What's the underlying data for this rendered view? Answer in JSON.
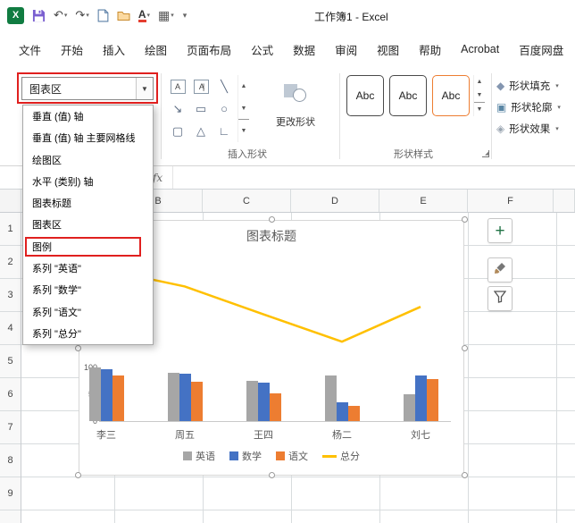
{
  "titlebar": {
    "title": "工作簿1 -  Excel"
  },
  "ribbon": {
    "tabs": [
      "文件",
      "开始",
      "插入",
      "绘图",
      "页面布局",
      "公式",
      "数据",
      "审阅",
      "视图",
      "帮助",
      "Acrobat",
      "百度网盘"
    ],
    "selection_combo": {
      "value": "图表区"
    },
    "groups": {
      "insert_shapes": {
        "label": "插入形状",
        "change_shape_label": "更改形状"
      },
      "shape_styles": {
        "label": "形状样式",
        "samples": [
          "Abc",
          "Abc",
          "Abc"
        ],
        "buttons": [
          "形状填充",
          "形状轮廓",
          "形状效果"
        ]
      }
    }
  },
  "formula_bar": {
    "fx": "fx"
  },
  "dropdown": {
    "items": [
      "垂直 (值) 轴",
      "垂直 (值) 轴 主要网格线",
      "绘图区",
      "水平 (类别) 轴",
      "图表标题",
      "图表区",
      "图例",
      "系列 \"英语\"",
      "系列 \"数学\"",
      "系列 \"语文\"",
      "系列 \"总分\""
    ],
    "highlighted": "图例"
  },
  "sheet": {
    "columns": [
      "B",
      "C",
      "D",
      "E",
      "F"
    ],
    "rows": [
      "1",
      "2",
      "3",
      "4",
      "5",
      "6",
      "7",
      "8",
      "9"
    ]
  },
  "chart_data": {
    "type": "combo",
    "title": "图表标题",
    "categories": [
      "李三",
      "周五",
      "王四",
      "杨二",
      "刘七"
    ],
    "series": [
      {
        "name": "英语",
        "type": "bar",
        "color": "#A6A6A6",
        "values": [
          100,
          90,
          75,
          85,
          50
        ]
      },
      {
        "name": "数学",
        "type": "bar",
        "color": "#4472C4",
        "values": [
          97,
          88,
          72,
          35,
          85
        ]
      },
      {
        "name": "语文",
        "type": "bar",
        "color": "#ED7D31",
        "values": [
          85,
          73,
          52,
          28,
          78
        ]
      },
      {
        "name": "总分",
        "type": "line",
        "color": "#FFC000",
        "values": [
          282,
          251,
          199,
          148,
          213
        ]
      }
    ],
    "y_ticks": [
      0,
      50,
      100
    ],
    "legend_position": "bottom",
    "grid": false
  },
  "colors": {
    "annotation": "#E0201F",
    "accent_green": "#107C41"
  }
}
